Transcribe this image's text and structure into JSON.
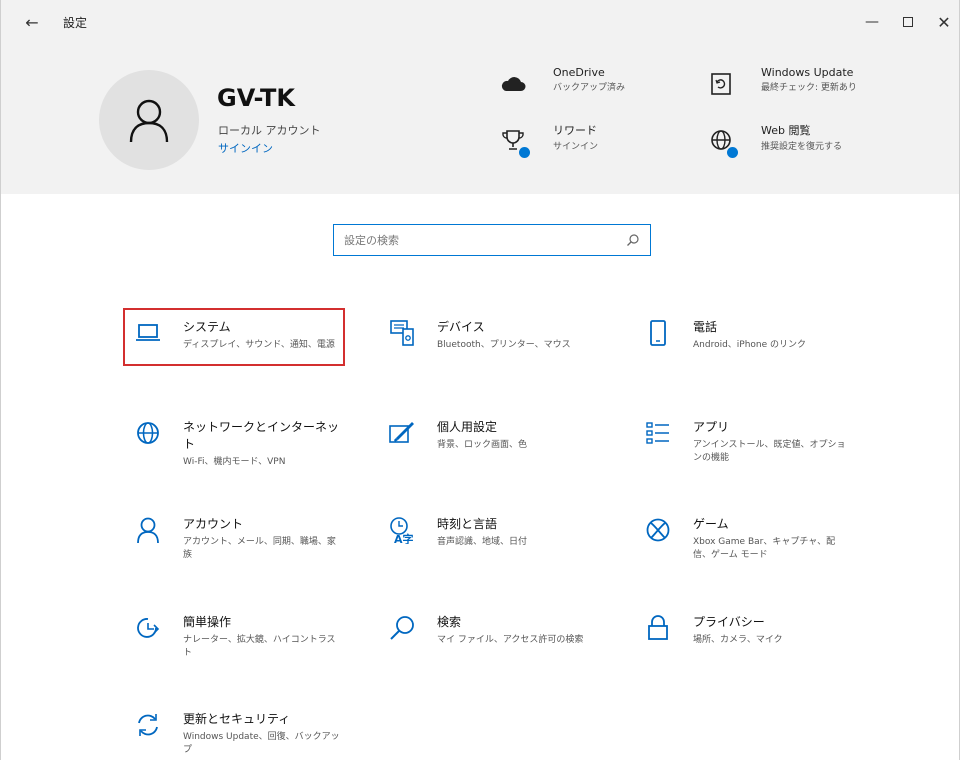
{
  "window": {
    "title": "設定",
    "back_glyph": "←",
    "minimize_glyph": "—",
    "close_glyph": "✕"
  },
  "header": {
    "user_name": "GV-TK",
    "account_type": "ローカル アカウント",
    "signin_label": "サインイン",
    "items": [
      {
        "title": "OneDrive",
        "subtitle": "バックアップ済み",
        "icon": "cloud-icon"
      },
      {
        "title": "Windows Update",
        "subtitle": "最終チェック: 更新あり",
        "icon": "windows-update-icon"
      },
      {
        "title": "リワード",
        "subtitle": "サインイン",
        "icon": "trophy-icon"
      },
      {
        "title": "Web 閲覧",
        "subtitle": "推奨設定を復元する",
        "icon": "globe-icon"
      }
    ]
  },
  "search": {
    "placeholder": "設定の検索"
  },
  "categories": [
    {
      "title": "システム",
      "subtitle": "ディスプレイ、サウンド、通知、電源",
      "icon": "laptop-icon"
    },
    {
      "title": "デバイス",
      "subtitle": "Bluetooth、プリンター、マウス",
      "icon": "devices-icon"
    },
    {
      "title": "電話",
      "subtitle": "Android、iPhone のリンク",
      "icon": "phone-icon"
    },
    {
      "title": "ネットワークとインターネット",
      "subtitle": "Wi-Fi、機内モード、VPN",
      "icon": "globe-icon"
    },
    {
      "title": "個人用設定",
      "subtitle": "背景、ロック画面、色",
      "icon": "paint-icon"
    },
    {
      "title": "アプリ",
      "subtitle": "アンインストール、既定値、オプションの機能",
      "icon": "apps-list-icon"
    },
    {
      "title": "アカウント",
      "subtitle": "アカウント、メール、同期、職場、家族",
      "icon": "person-icon"
    },
    {
      "title": "時刻と言語",
      "subtitle": "音声認識、地域、日付",
      "icon": "time-language-icon"
    },
    {
      "title": "ゲーム",
      "subtitle": "Xbox Game Bar、キャプチャ、配信、ゲーム モード",
      "icon": "xbox-icon"
    },
    {
      "title": "簡単操作",
      "subtitle": "ナレーター、拡大鏡、ハイコントラスト",
      "icon": "ease-of-access-icon"
    },
    {
      "title": "検索",
      "subtitle": "マイ ファイル、アクセス許可の検索",
      "icon": "search-icon"
    },
    {
      "title": "プライバシー",
      "subtitle": "場所、カメラ、マイク",
      "icon": "lock-icon"
    },
    {
      "title": "更新とセキュリティ",
      "subtitle": "Windows Update、回復、バックアップ",
      "icon": "sync-icon"
    }
  ],
  "colors": {
    "accent": "#0078d4",
    "highlight": "#d32f2f",
    "header_bg": "#f2f2f2"
  }
}
